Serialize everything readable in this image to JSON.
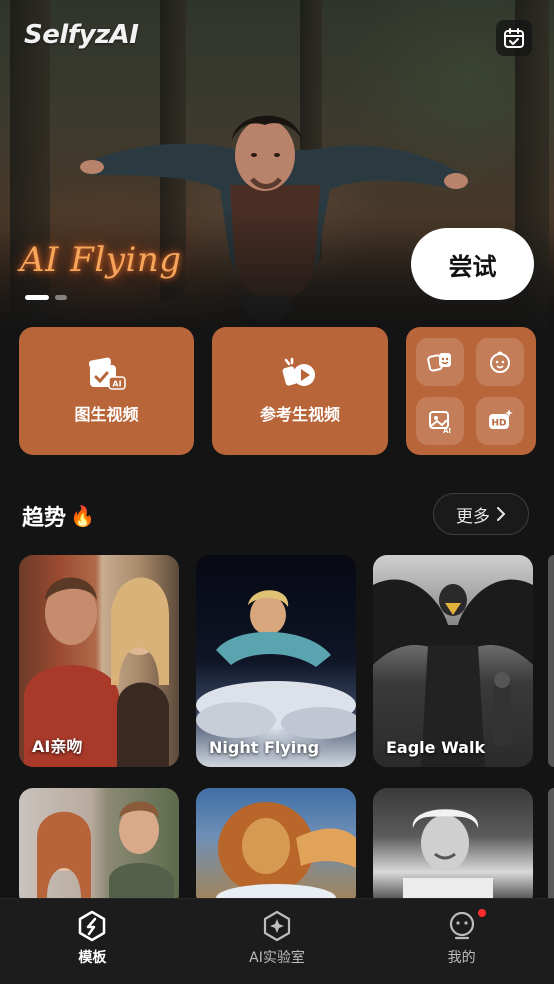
{
  "header": {
    "logo": "SelfyzAI",
    "calendar_icon": "calendar-check-icon"
  },
  "hero": {
    "title": "AI Flying",
    "try_button": "尝试",
    "carousel": {
      "count": 2,
      "active_index": 0
    }
  },
  "features": {
    "image_to_video": {
      "label": "图生视频",
      "icon": "image-ai-icon"
    },
    "reference_video": {
      "label": "参考生视频",
      "icon": "reference-video-icon"
    },
    "tools": [
      {
        "icon": "face-swap-icon"
      },
      {
        "icon": "baby-face-icon"
      },
      {
        "icon": "ai-photo-icon"
      },
      {
        "icon": "hd-enhance-icon"
      }
    ]
  },
  "trending": {
    "title": "趋势",
    "title_emoji": "🔥",
    "more_label": "更多",
    "row1": [
      {
        "caption": "AI亲吻"
      },
      {
        "caption": "Night Flying"
      },
      {
        "caption": "Eagle Walk"
      }
    ],
    "row2": [
      {
        "caption": ""
      },
      {
        "caption": ""
      },
      {
        "caption": ""
      }
    ]
  },
  "bottom_nav": {
    "items": [
      {
        "label": "模板",
        "icon": "template-icon",
        "active": true
      },
      {
        "label": "AI实验室",
        "icon": "ai-lab-icon",
        "active": false
      },
      {
        "label": "我的",
        "icon": "profile-icon",
        "active": false,
        "has_notification": true
      }
    ]
  },
  "colors": {
    "accent": "#B8653A",
    "background": "#141414",
    "hero_title": "#F6A55A",
    "notification": "#FF2D2D"
  }
}
